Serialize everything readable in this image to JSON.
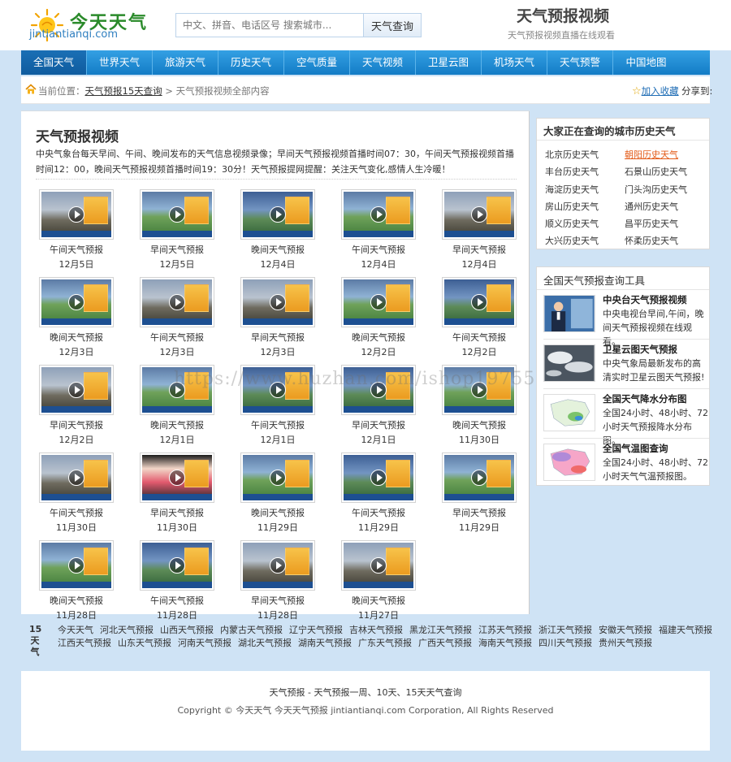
{
  "logo": {
    "cn": "今天天气",
    "en": "jintiantianqi.com"
  },
  "search": {
    "placeholder": "中文、拼音、电话区号 搜索城市...",
    "button": "天气查询"
  },
  "header": {
    "title": "天气预报视频",
    "subtitle": "天气预报视频直播在线观看"
  },
  "nav": [
    "全国天气",
    "世界天气",
    "旅游天气",
    "历史天气",
    "空气质量",
    "天气视频",
    "卫星云图",
    "机场天气",
    "天气预警",
    "中国地图"
  ],
  "breadcrumb": {
    "prefix": "当前位置：",
    "link": "天气预报15天查询",
    "sep": " > ",
    "current": "天气预报视频全部内容"
  },
  "fav": {
    "label": "加入收藏",
    "share": "分享到:"
  },
  "main": {
    "title": "天气预报视频",
    "intro": "中央气象台每天早间、午间、晚间发布的天气信息视频录像；早间天气预报视频首播时间07：30，午间天气预报视频首播时间12：00，晚间天气预报视频首播时间19：30分！天气预报提网提醒：关注天气变化,感情人生冷暖！"
  },
  "videos": [
    {
      "title": "午间天气预报",
      "date": "12月5日"
    },
    {
      "title": "早间天气预报",
      "date": "12月5日"
    },
    {
      "title": "晚间天气预报",
      "date": "12月4日"
    },
    {
      "title": "午间天气预报",
      "date": "12月4日"
    },
    {
      "title": "早间天气预报",
      "date": "12月4日"
    },
    {
      "title": "晚间天气预报",
      "date": "12月3日"
    },
    {
      "title": "午间天气预报",
      "date": "12月3日"
    },
    {
      "title": "早间天气预报",
      "date": "12月3日"
    },
    {
      "title": "晚间天气预报",
      "date": "12月2日"
    },
    {
      "title": "午间天气预报",
      "date": "12月2日"
    },
    {
      "title": "早间天气预报",
      "date": "12月2日"
    },
    {
      "title": "晚间天气预报",
      "date": "12月1日"
    },
    {
      "title": "午间天气预报",
      "date": "12月1日"
    },
    {
      "title": "早间天气预报",
      "date": "12月1日"
    },
    {
      "title": "晚间天气预报",
      "date": "11月30日"
    },
    {
      "title": "午间天气预报",
      "date": "11月30日"
    },
    {
      "title": "早间天气预报",
      "date": "11月30日"
    },
    {
      "title": "晚间天气预报",
      "date": "11月29日"
    },
    {
      "title": "午间天气预报",
      "date": "11月29日"
    },
    {
      "title": "早间天气预报",
      "date": "11月29日"
    },
    {
      "title": "晚间天气预报",
      "date": "11月28日"
    },
    {
      "title": "午间天气预报",
      "date": "11月28日"
    },
    {
      "title": "早间天气预报",
      "date": "11月28日"
    },
    {
      "title": "晚间天气预报",
      "date": "11月27日"
    }
  ],
  "sidebar": {
    "history_title": "大家正在查询的城市历史天气",
    "cities": [
      "北京历史天气",
      "朝阳历史天气",
      "丰台历史天气",
      "石景山历史天气",
      "海淀历史天气",
      "门头沟历史天气",
      "房山历史天气",
      "通州历史天气",
      "顺义历史天气",
      "昌平历史天气",
      "大兴历史天气",
      "怀柔历史天气"
    ],
    "tools_title": "全国天气预报查询工具",
    "tools": [
      {
        "title": "中央台天气预报视频",
        "desc": "中央电视台早间,午间，晚间天气预报视频在线观看。"
      },
      {
        "title": "卫星云图天气预报",
        "desc": "中央气象局最新发布的高清实时卫星云图天气预报!"
      },
      {
        "title": "全国天气降水分布图",
        "desc": "全国24小时、48小时、72小时天气预报降水分布图。"
      },
      {
        "title": "全国气温图查询",
        "desc": "全国24小时、48小时、72小时天气气温预报图。"
      }
    ]
  },
  "watermark": "https://www.huzhan.com/ishop19755",
  "links": {
    "label": "15天气",
    "row1": [
      "今天天气",
      "河北天气预报",
      "山西天气预报",
      "内蒙古天气预报",
      "辽宁天气预报",
      "吉林天气预报",
      "黑龙江天气预报",
      "江苏天气预报",
      "浙江天气预报",
      "安徽天气预报",
      "福建天气预报"
    ],
    "row2": [
      "江西天气预报",
      "山东天气预报",
      "河南天气预报",
      "湖北天气预报",
      "湖南天气预报",
      "广东天气预报",
      "广西天气预报",
      "海南天气预报",
      "四川天气预报",
      "贵州天气预报"
    ]
  },
  "footer": {
    "line1": "天气预报 - 天气预报一周、10天、15天天气查询",
    "line2": "Copyright © 今天天气 今天天气预报 jintiantianqi.com Corporation, All Rights Reserved"
  }
}
